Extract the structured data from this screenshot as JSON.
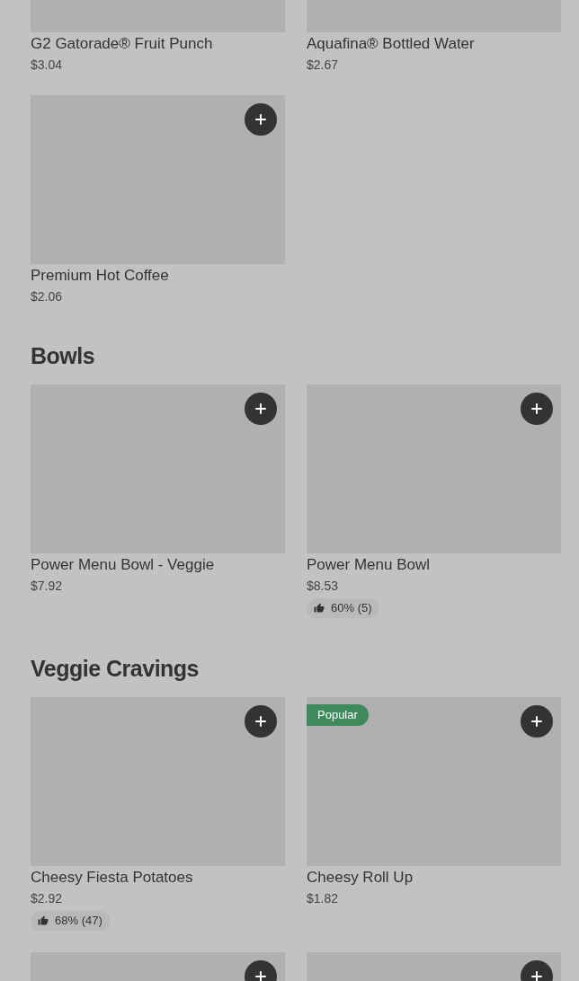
{
  "sections": [
    {
      "items": [
        {
          "kind": "top-cut",
          "name": "G2 Gatorade® Fruit Punch",
          "price": "$3.04"
        },
        {
          "kind": "top-cut",
          "name": "Aquafina® Bottled Water",
          "price": "$2.67"
        },
        {
          "kind": "full",
          "name": "Premium Hot Coffee",
          "price": "$2.06"
        }
      ]
    },
    {
      "title": "Bowls",
      "items": [
        {
          "kind": "full",
          "name": "Power Menu Bowl - Veggie",
          "price": "$7.92"
        },
        {
          "kind": "full",
          "name": "Power Menu Bowl",
          "price": "$8.53",
          "rating": "60% (5)"
        }
      ]
    },
    {
      "title": "Veggie Cravings",
      "items": [
        {
          "kind": "full",
          "name": "Cheesy Fiesta Potatoes",
          "price": "$2.92",
          "rating": "68% (47)"
        },
        {
          "kind": "full",
          "name": "Cheesy Roll Up",
          "price": "$1.82",
          "badge": "Popular"
        },
        {
          "kind": "bottom-cut"
        },
        {
          "kind": "bottom-cut"
        }
      ]
    }
  ]
}
